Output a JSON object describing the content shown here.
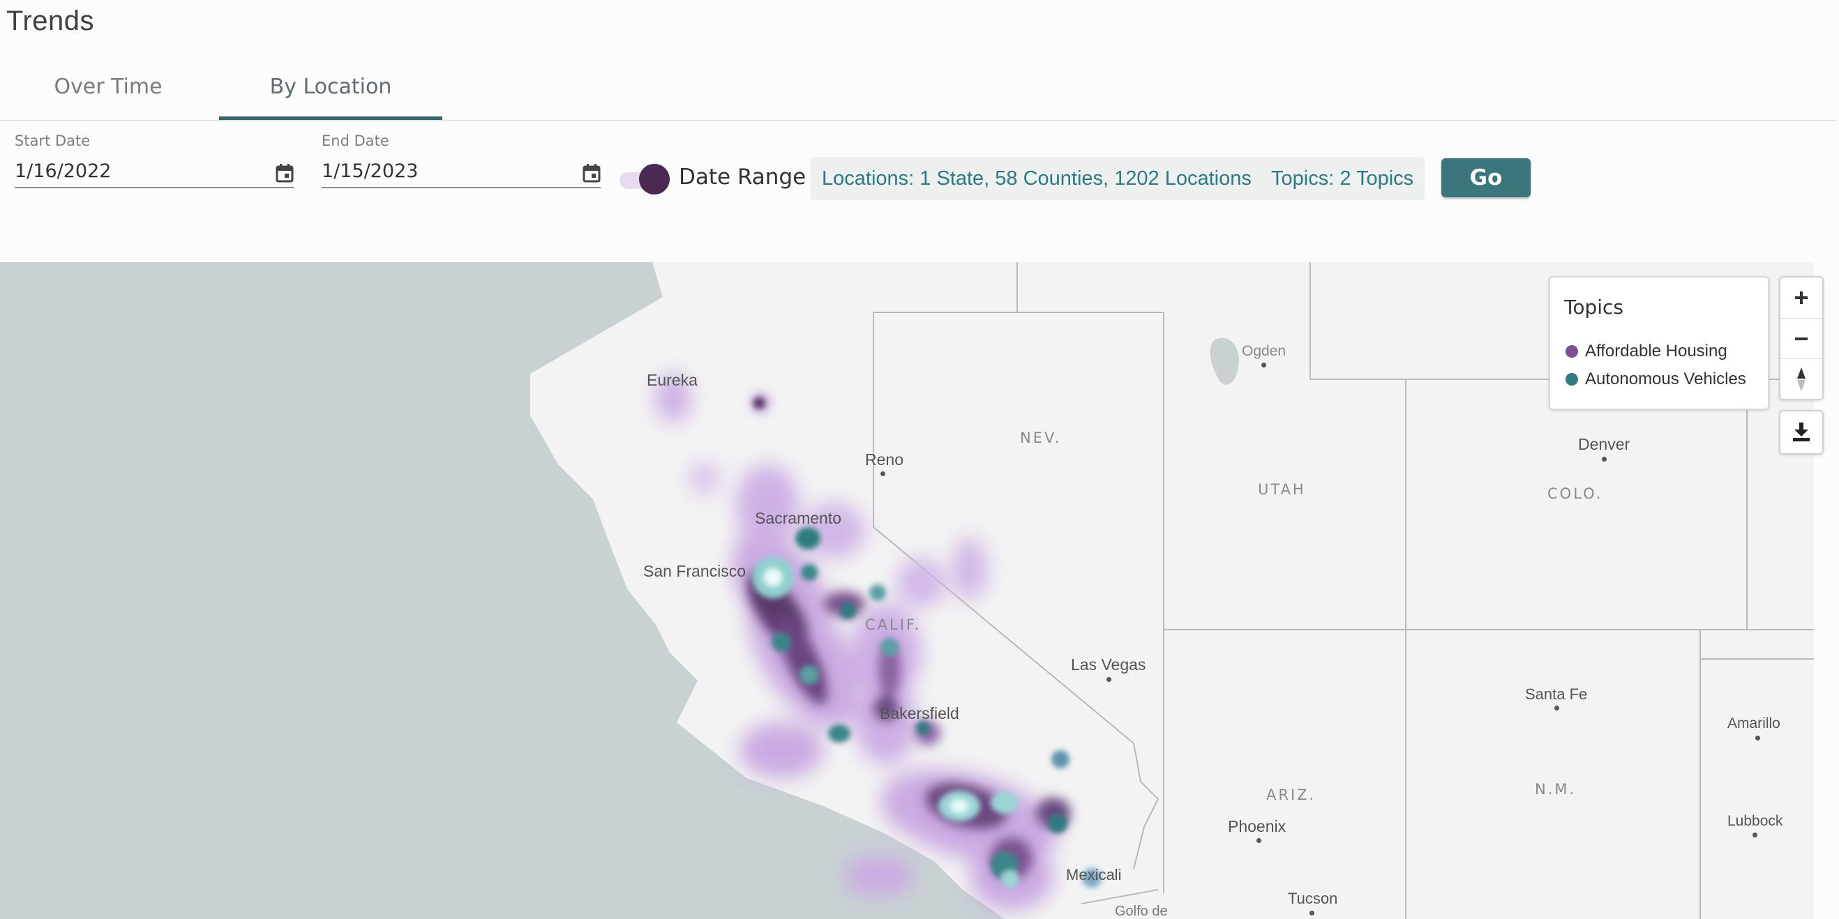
{
  "page_title": "Trends",
  "tabs": [
    {
      "label": "Over Time",
      "active": false
    },
    {
      "label": "By Location",
      "active": true
    }
  ],
  "filters": {
    "start_date": {
      "label": "Start Date",
      "value": "1/16/2022"
    },
    "end_date": {
      "label": "End Date",
      "value": "1/15/2023"
    },
    "date_range_toggle": {
      "label": "Date Range",
      "checked": true
    },
    "locations_chip": "Locations: 1 State, 58 Counties, 1202 Locations",
    "topics_chip": "Topics: 2 Topics",
    "go_button": "Go"
  },
  "map": {
    "legend": {
      "title": "Topics",
      "items": [
        {
          "label": "Affordable Housing",
          "color": "#7d4f96"
        },
        {
          "label": "Autonomous Vehicles",
          "color": "#2f7b80"
        }
      ]
    },
    "city_labels": {
      "eureka": "Eureka",
      "reno": "Reno",
      "sacramento": "Sacramento",
      "san_francisco": "San Francisco",
      "bakersfield": "Bakersfield",
      "las_vegas": "Las Vegas",
      "ogden": "Ogden",
      "denver": "Denver",
      "santa_fe": "Santa Fe",
      "amarillo": "Amarillo",
      "lubbock": "Lubbock",
      "phoenix": "Phoenix",
      "tucson": "Tucson",
      "mexicali": "Mexicali",
      "golfo": "Golfo de"
    },
    "state_labels": {
      "nev": "NEV.",
      "utah": "UTAH",
      "colo": "COLO.",
      "calif": "CALIF.",
      "ariz": "ARIZ.",
      "nm": "N.M."
    },
    "controls": {
      "zoom_in": "zoom-in",
      "zoom_out": "zoom-out",
      "reset_north": "compass",
      "download": "download"
    }
  }
}
